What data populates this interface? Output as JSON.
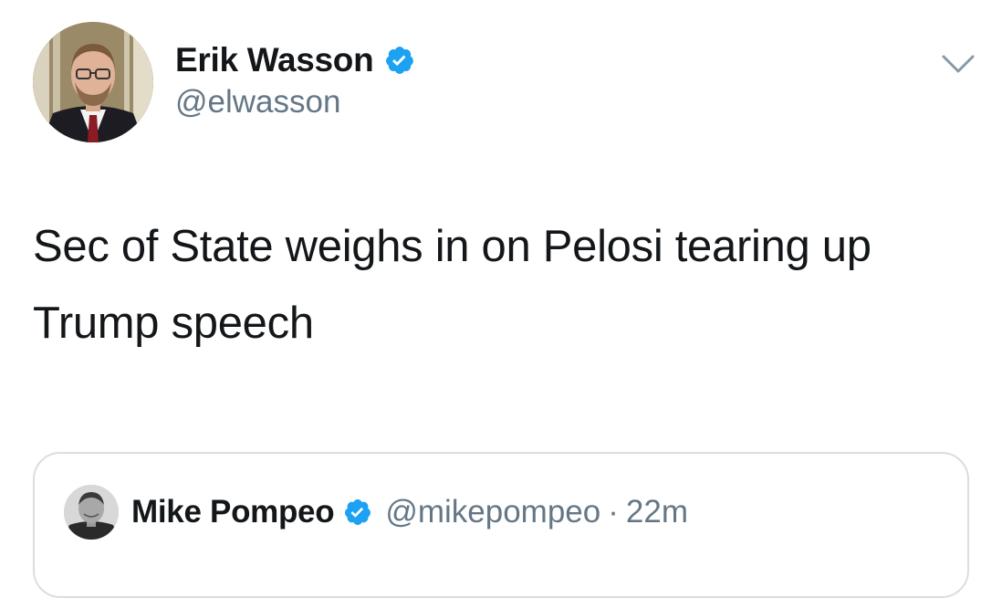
{
  "tweet": {
    "author": {
      "display_name": "Erik Wasson",
      "handle": "@elwasson",
      "verified": true
    },
    "text": "Sec of State weighs in on Pelosi tearing up Trump speech",
    "menu_icon": "chevron-down-icon"
  },
  "quoted_tweet": {
    "author": {
      "display_name": "Mike Pompeo",
      "handle": "@mikepompeo",
      "verified": true
    },
    "separator": "·",
    "timestamp": "22m"
  },
  "colors": {
    "verified_blue": "#1da1f2",
    "text_primary": "#14171a",
    "text_secondary": "#657786",
    "border": "#d8dee3"
  }
}
